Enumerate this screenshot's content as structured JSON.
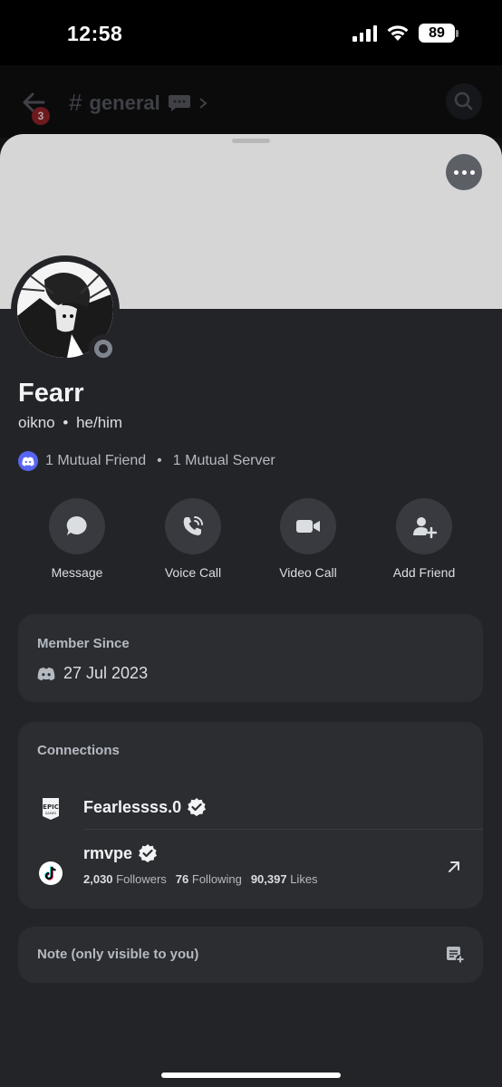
{
  "status_bar": {
    "time": "12:58",
    "battery": "89"
  },
  "background_header": {
    "channel_name": "general",
    "back_badge_count": "3"
  },
  "profile": {
    "display_name": "Fearr",
    "username": "oikno",
    "pronouns": "he/him",
    "separator": "•",
    "mutual_friends": "1 Mutual Friend",
    "mutual_servers": "1 Mutual Server"
  },
  "actions": [
    {
      "label": "Message",
      "icon": "message-bubble-icon"
    },
    {
      "label": "Voice Call",
      "icon": "phone-call-icon"
    },
    {
      "label": "Video Call",
      "icon": "video-camera-icon"
    },
    {
      "label": "Add Friend",
      "icon": "add-friend-icon"
    }
  ],
  "member_since": {
    "title": "Member Since",
    "date": "27 Jul 2023"
  },
  "connections": {
    "title": "Connections",
    "items": [
      {
        "platform": "epic-games",
        "name": "Fearlessss.0",
        "verified": true
      },
      {
        "platform": "tiktok",
        "name": "rmvpe",
        "verified": true,
        "followers_value": "2,030",
        "followers_label": "Followers",
        "following_value": "76",
        "following_label": "Following",
        "likes_value": "90,397",
        "likes_label": "Likes"
      }
    ]
  },
  "note": {
    "placeholder": "Note (only visible to you)"
  },
  "colors": {
    "sheet_bg": "#232428",
    "card_bg": "#2b2d31",
    "banner": "#d6d6d6",
    "blurple": "#5865f2",
    "status_offline": "#80848e"
  }
}
